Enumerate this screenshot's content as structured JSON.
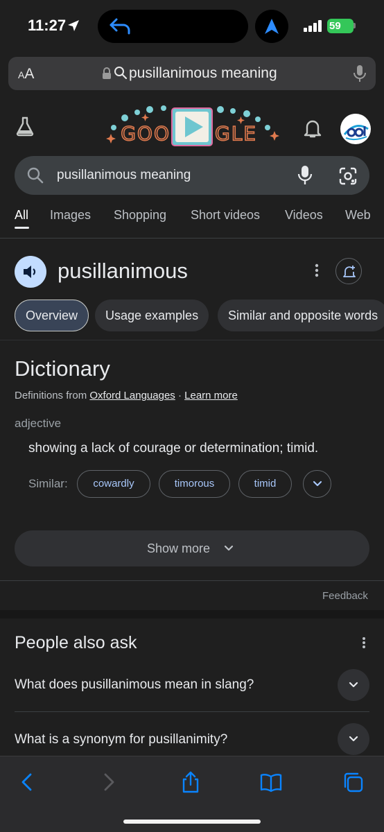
{
  "status_bar": {
    "time": "11:27",
    "battery": "59"
  },
  "browser": {
    "aa_label_small": "A",
    "aa_label_big": "A",
    "url_text": "pusillanimous meaning"
  },
  "doodle": {
    "text_left": "GOO",
    "text_right": "GLE"
  },
  "search": {
    "query": "pusillanimous meaning"
  },
  "tabs": [
    "All",
    "Images",
    "Shopping",
    "Short videos",
    "Videos",
    "Web"
  ],
  "word_header": {
    "word": "pusillanimous"
  },
  "chips": [
    "Overview",
    "Usage examples",
    "Similar and opposite words"
  ],
  "dictionary": {
    "title": "Dictionary",
    "source_prefix": "Definitions from ",
    "source_link": "Oxford Languages",
    "separator": " · ",
    "learn_more": "Learn more",
    "part_of_speech": "adjective",
    "definition": "showing a lack of courage or determination; timid.",
    "similar_label": "Similar:",
    "similar_words": [
      "cowardly",
      "timorous",
      "timid"
    ],
    "show_more": "Show more",
    "feedback": "Feedback"
  },
  "people_also_ask": {
    "title": "People also ask",
    "questions": [
      "What does pusillanimous mean in slang?",
      "What is a synonym for pusillanimity?"
    ]
  },
  "colors": {
    "accent_blue": "#a8c7fa",
    "toolbar_blue": "#0a84ff",
    "battery_green": "#34c759",
    "page_background": "#1f1f1f"
  }
}
